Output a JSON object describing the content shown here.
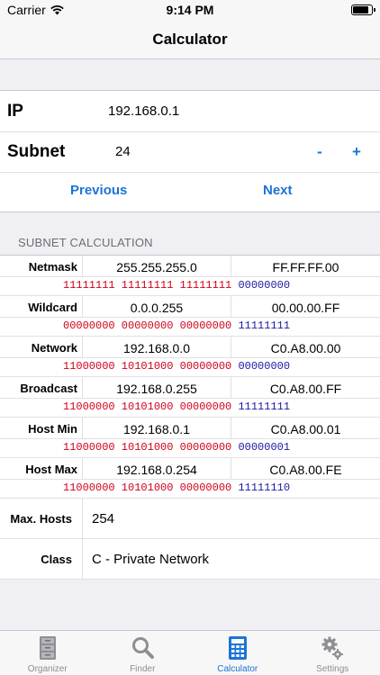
{
  "status_bar": {
    "carrier": "Carrier",
    "time": "9:14 PM",
    "battery_level": 0.85
  },
  "nav": {
    "title": "Calculator"
  },
  "inputs": {
    "ip_label": "IP",
    "ip_value": "192.168.0.1",
    "subnet_label": "Subnet",
    "subnet_value": "24",
    "minus_label": "-",
    "plus_label": "+",
    "previous_label": "Previous",
    "next_label": "Next"
  },
  "section_header": "SUBNET CALCULATION",
  "results": [
    {
      "label": "Netmask",
      "dec": "255.255.255.0",
      "hex": "FF.FF.FF.00",
      "bin_net": "11111111 11111111 11111111 ",
      "bin_host": "00000000"
    },
    {
      "label": "Wildcard",
      "dec": "0.0.0.255",
      "hex": "00.00.00.FF",
      "bin_net": "00000000 00000000 00000000 ",
      "bin_host": "11111111"
    },
    {
      "label": "Network",
      "dec": "192.168.0.0",
      "hex": "C0.A8.00.00",
      "bin_net": "11000000 10101000 00000000 ",
      "bin_host": "00000000"
    },
    {
      "label": "Broadcast",
      "dec": "192.168.0.255",
      "hex": "C0.A8.00.FF",
      "bin_net": "11000000 10101000 00000000 ",
      "bin_host": "11111111"
    },
    {
      "label": "Host Min",
      "dec": "192.168.0.1",
      "hex": "C0.A8.00.01",
      "bin_net": "11000000 10101000 00000000 ",
      "bin_host": "00000001"
    },
    {
      "label": "Host Max",
      "dec": "192.168.0.254",
      "hex": "C0.A8.00.FE",
      "bin_net": "11000000 10101000 00000000 ",
      "bin_host": "11111110"
    }
  ],
  "info": [
    {
      "label": "Max. Hosts",
      "value": "254"
    },
    {
      "label": "Class",
      "value": "C - Private Network"
    }
  ],
  "tabs": [
    {
      "label": "Organizer",
      "icon": "cabinet-icon",
      "active": false
    },
    {
      "label": "Finder",
      "icon": "magnifier-icon",
      "active": false
    },
    {
      "label": "Calculator",
      "icon": "calculator-icon",
      "active": true
    },
    {
      "label": "Settings",
      "icon": "gears-icon",
      "active": false
    }
  ],
  "colors": {
    "accent": "#1a74d6",
    "network_bits": "#d0021b",
    "host_bits": "#1a1aa6",
    "inactive_tab": "#8e8e93"
  }
}
